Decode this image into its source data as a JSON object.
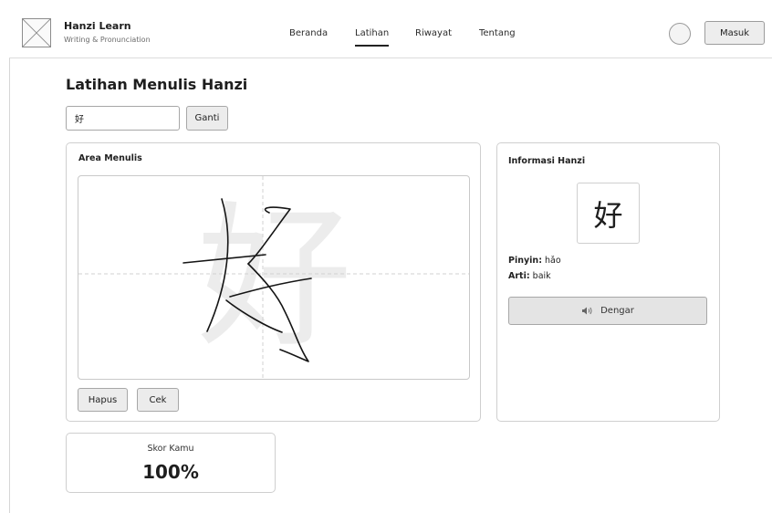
{
  "brand": {
    "title": "Hanzi Learn",
    "subtitle": "Writing & Pronunciation"
  },
  "nav": [
    {
      "label": "Beranda",
      "active": false
    },
    {
      "label": "Latihan",
      "active": true
    },
    {
      "label": "Riwayat",
      "active": false
    },
    {
      "label": "Tentang",
      "active": false
    }
  ],
  "header": {
    "login_label": "Masuk"
  },
  "main": {
    "title": "Latihan Menulis Hanzi",
    "input_value": "好",
    "change_label": "Ganti"
  },
  "writing": {
    "title": "Area Menulis",
    "guide_char": "好",
    "clear_label": "Hapus",
    "check_label": "Cek"
  },
  "info": {
    "title": "Informasi Hanzi",
    "char": "好",
    "pinyin_label": "Pinyin:",
    "pinyin_value": "hǎo",
    "meaning_label": "Arti:",
    "meaning_value": "baik",
    "listen_label": "Dengar"
  },
  "score": {
    "label": "Skor Kamu",
    "value": "100%"
  },
  "icons": {
    "logo": "image-placeholder-icon",
    "avatar": "avatar-circle",
    "listen": "speaker-icon"
  }
}
